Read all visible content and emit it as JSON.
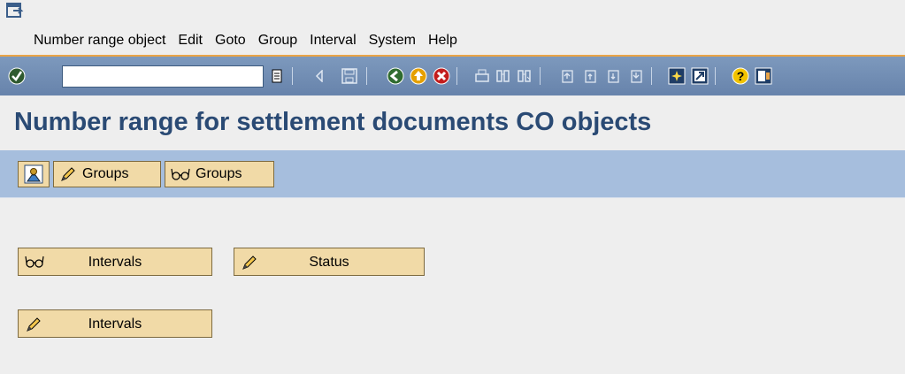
{
  "menu": {
    "items": [
      {
        "label": "Number range object"
      },
      {
        "label": "Edit"
      },
      {
        "label": "Goto"
      },
      {
        "label": "Group"
      },
      {
        "label": "Interval"
      },
      {
        "label": "System"
      },
      {
        "label": "Help"
      }
    ]
  },
  "toolbar": {
    "command_field_value": "",
    "icons": [
      "enter-icon",
      "command-dropdown-icon",
      "back-arrow-icon",
      "save-icon",
      "back-icon",
      "exit-icon",
      "cancel-icon",
      "print-icon",
      "find-icon",
      "find-next-icon",
      "first-page-icon",
      "previous-page-icon",
      "next-page-icon",
      "last-page-icon",
      "new-session-icon",
      "shortcut-icon",
      "help-icon",
      "layout-icon"
    ]
  },
  "title": "Number range for settlement documents CO objects",
  "app_toolbar": {
    "buttons": [
      {
        "icon": "overview-icon",
        "label": ""
      },
      {
        "icon": "pencil-icon",
        "label": "Groups"
      },
      {
        "icon": "glasses-icon",
        "label": "Groups"
      }
    ]
  },
  "main": {
    "buttons": [
      {
        "icon": "glasses-icon",
        "label": "Intervals"
      },
      {
        "icon": "pencil-icon",
        "label": "Status"
      },
      {
        "icon": "pencil-icon",
        "label": "Intervals"
      }
    ]
  },
  "colors": {
    "menu_rule": "#e9a447",
    "toolbar": "#6f8cb3",
    "title": "#2a4a74",
    "app_toolbar": "#a6bedd",
    "button_face": "#f1daa7"
  }
}
